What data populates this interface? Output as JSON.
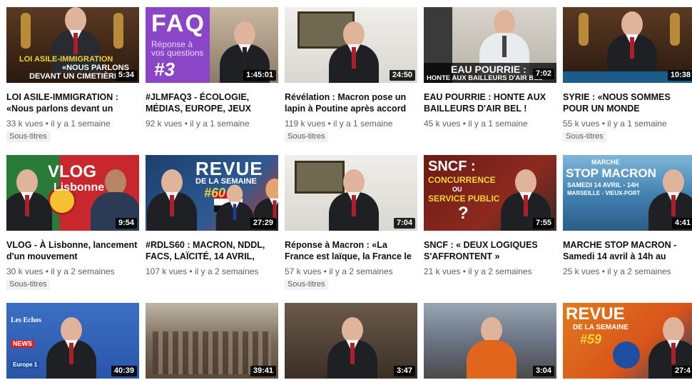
{
  "videos": [
    {
      "title": "LOI ASILE-IMMIGRATION : «Nous parlons devant un",
      "views": "33 k vues",
      "date": "il y a 1 semaine",
      "badge": "Sous-titres",
      "duration": "5:34",
      "caption1": "LOI ASILE-IMMIGRATION",
      "caption2": "«NOUS PARLONS",
      "caption3": "DEVANT UN CIMETIÈRE"
    },
    {
      "title": "#JLMFAQ3 - ÉCOLOGIE, MÉDIAS, EUROPE, JEUX",
      "views": "92 k vues",
      "date": "il y a 1 semaine",
      "badge": "",
      "duration": "1:45:01",
      "caption1": "FAQ",
      "caption2": "Réponse à",
      "caption3": "vos questions",
      "caption4": "#3"
    },
    {
      "title": "Révélation : Macron pose un lapin à Poutine après accord",
      "views": "119 k vues",
      "date": "il y a 1 semaine",
      "badge": "Sous-titres",
      "duration": "24:50"
    },
    {
      "title": "EAU POURRIE : HONTE AUX BAILLEURS D'AIR BEL !",
      "views": "45 k vues",
      "date": "il y a 1 semaine",
      "badge": "",
      "duration": "7:02",
      "caption1": "EAU POURRIE :",
      "caption2": "HONTE AUX BAILLEURS D'AIR BEL"
    },
    {
      "title": "SYRIE : «NOUS SOMMES POUR UN MONDE",
      "views": "55 k vues",
      "date": "il y a 1 semaine",
      "badge": "Sous-titres",
      "duration": "10:38"
    },
    {
      "title": "VLOG - À Lisbonne, lancement d'un mouvement",
      "views": "30 k vues",
      "date": "il y a 2 semaines",
      "badge": "Sous-titres",
      "duration": "9:54",
      "caption1": "VLOG",
      "caption2": "Lisbonne"
    },
    {
      "title": "#RDLS60 : MACRON, NDDL, FACS, LAÏCITÉ, 14 AVRIL,",
      "views": "107 k vues",
      "date": "il y a 2 semaines",
      "badge": "",
      "duration": "27:29",
      "caption1": "REVUE",
      "caption2": "DE LA SEMAINE",
      "caption3": "#60"
    },
    {
      "title": "Réponse à Macron : «La France est laïque, la France le",
      "views": "57 k vues",
      "date": "il y a 2 semaines",
      "badge": "Sous-titres",
      "duration": "7:04"
    },
    {
      "title": "SNCF : « DEUX LOGIQUES S'AFFRONTENT »",
      "views": "21 k vues",
      "date": "il y a 2 semaines",
      "badge": "",
      "duration": "7:55",
      "caption1": "SNCF :",
      "caption2": "CONCURRENCE",
      "caption3": "OU",
      "caption4": "SERVICE PUBLIC",
      "caption5": "?"
    },
    {
      "title": "MARCHE STOP MACRON - Samedi 14 avril à 14h au",
      "views": "25 k vues",
      "date": "il y a 2 semaines",
      "badge": "",
      "duration": "4:41",
      "caption1": "MARCHE",
      "caption2": "STOP MACRON",
      "caption3": "SAMEDI 14 AVRIL - 14H",
      "caption4": "MARSEILLE - VIEUX-PORT"
    },
    {
      "duration": "40:39",
      "caption1": "Les Echos",
      "caption2": "NEWS",
      "caption3": "Europe 1"
    },
    {
      "duration": "39:41"
    },
    {
      "duration": "3:47"
    },
    {
      "duration": "3:04"
    },
    {
      "duration": "27:4",
      "caption1": "REVUE",
      "caption2": "DE LA SEMAINE",
      "caption3": "#59"
    }
  ],
  "separator": "•"
}
